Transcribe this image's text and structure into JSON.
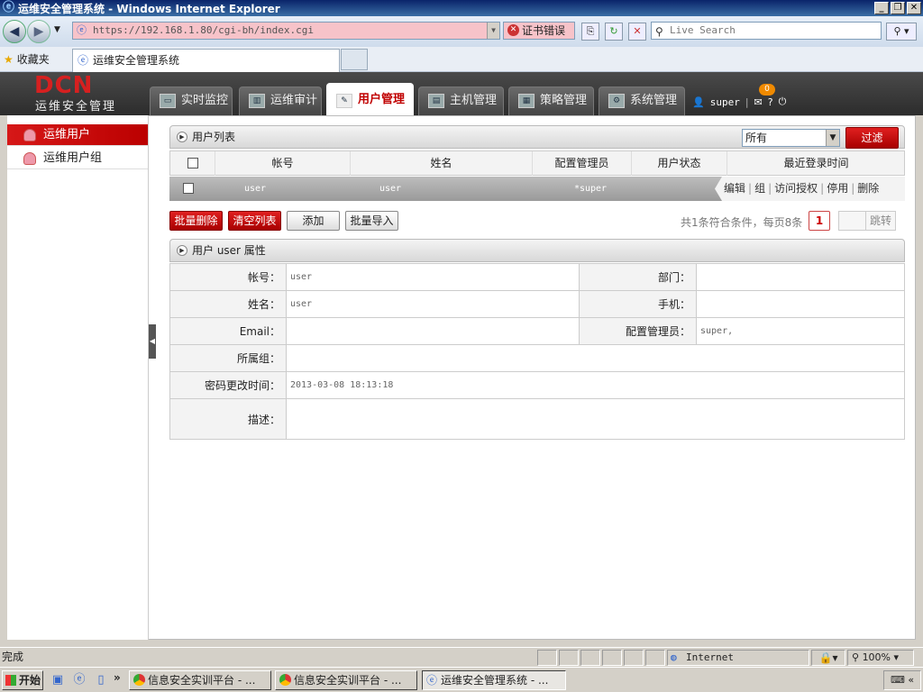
{
  "browser": {
    "window_title": "运维安全管理系统 - Windows Internet Explorer",
    "url": "https://192.168.1.80/cgi-bh/index.cgi",
    "cert_error": "证书错误",
    "search_placeholder": "Live Search",
    "favorites_label": "收藏夹",
    "tab_title": "运维安全管理系统"
  },
  "app": {
    "logo_text": "DCN",
    "logo_subtitle": "运维安全管理",
    "nav_tabs": [
      {
        "label": "实时监控"
      },
      {
        "label": "运维审计"
      },
      {
        "label": "用户管理"
      },
      {
        "label": "主机管理"
      },
      {
        "label": "策略管理"
      },
      {
        "label": "系统管理"
      }
    ],
    "user": "super",
    "message_count": "0",
    "help": "?",
    "logout_icon": "power-icon"
  },
  "sidebar": {
    "items": [
      {
        "label": "运维用户"
      },
      {
        "label": "运维用户组"
      }
    ]
  },
  "user_list": {
    "title": "用户列表",
    "filter_value": "所有",
    "filter_button": "过滤",
    "columns": [
      "帐号",
      "姓名",
      "配置管理员",
      "用户状态",
      "最近登录时间"
    ],
    "rows": [
      {
        "account": "user",
        "name": "user",
        "admin": "*super",
        "status": "",
        "last_login": ""
      }
    ],
    "row_actions": [
      "编辑",
      "组",
      "访问授权",
      "停用",
      "删除"
    ],
    "buttons": {
      "batch_delete": "批量删除",
      "clear_list": "清空列表",
      "add": "添加",
      "batch_import": "批量导入"
    },
    "pagination": {
      "info": "共1条符合条件，每页8条",
      "current_page": "1",
      "jump": "跳转"
    }
  },
  "properties": {
    "title": "用户 user 属性",
    "account_label": "帐号：",
    "account": "user",
    "dept_label": "部门：",
    "dept": "",
    "name_label": "姓名：",
    "name": "user",
    "phone_label": "手机：",
    "phone": "",
    "email_label": "Email：",
    "email": "",
    "admin_label": "配置管理员：",
    "admin": "super,",
    "group_label": "所属组：",
    "group": "",
    "pwd_time_label": "密码更改时间：",
    "pwd_time": "2013-03-08 18:13:18",
    "desc_label": "描述：",
    "desc": ""
  },
  "statusbar": {
    "status": "完成",
    "zone": "Internet",
    "zoom": "100%"
  },
  "taskbar": {
    "start": "开始",
    "tasks": [
      {
        "label": "信息安全实训平台 - ..."
      },
      {
        "label": "信息安全实训平台 - ..."
      },
      {
        "label": "运维安全管理系统 - ..."
      }
    ]
  },
  "colors": {
    "accent_red": "#c00000",
    "header_dark": "#333333"
  }
}
